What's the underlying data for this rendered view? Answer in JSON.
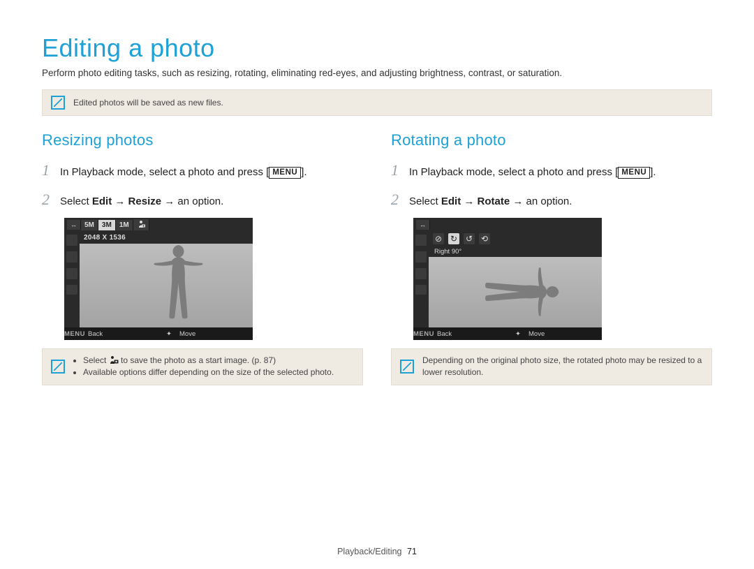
{
  "header": {
    "title": "Editing a photo",
    "intro": "Perform photo editing tasks, such as resizing, rotating, eliminating red-eyes, and adjusting brightness, contrast, or saturation."
  },
  "top_note": "Edited photos will be saved as new files.",
  "left": {
    "subhead": "Resizing photos",
    "step1_num": "1",
    "step1_a": "In Playback mode, select a photo and press [",
    "step1_menu": "MENU",
    "step1_b": "].",
    "step2_num": "2",
    "step2_a": "Select ",
    "step2_b": "Edit",
    "step2_c": "Resize",
    "step2_d": " an option.",
    "arrow": "→",
    "cam": {
      "chips": [
        "5M",
        "3M",
        "1M"
      ],
      "res_line": "2048 X 1536",
      "back": "Back",
      "menu": "MENU",
      "move": "Move",
      "move_glyph": "✦"
    },
    "note_b1_a": "Select ",
    "note_b1_b": " to save the photo as a start image. (p. 87)",
    "note_b2": "Available options differ depending on the size of the selected photo."
  },
  "right": {
    "subhead": "Rotating a photo",
    "step1_num": "1",
    "step1_a": "In Playback mode, select a photo and press [",
    "step1_menu": "MENU",
    "step1_b": "].",
    "step2_num": "2",
    "step2_a": "Select ",
    "step2_b": "Edit",
    "step2_c": "Rotate",
    "step2_d": " an option.",
    "arrow": "→",
    "cam": {
      "rot_label": "Right 90°",
      "back": "Back",
      "menu": "MENU",
      "move": "Move",
      "move_glyph": "✦"
    },
    "note": "Depending on the original photo size, the rotated photo may be resized to a lower resolution."
  },
  "footer": {
    "section": "Playback/Editing",
    "page": "71"
  }
}
